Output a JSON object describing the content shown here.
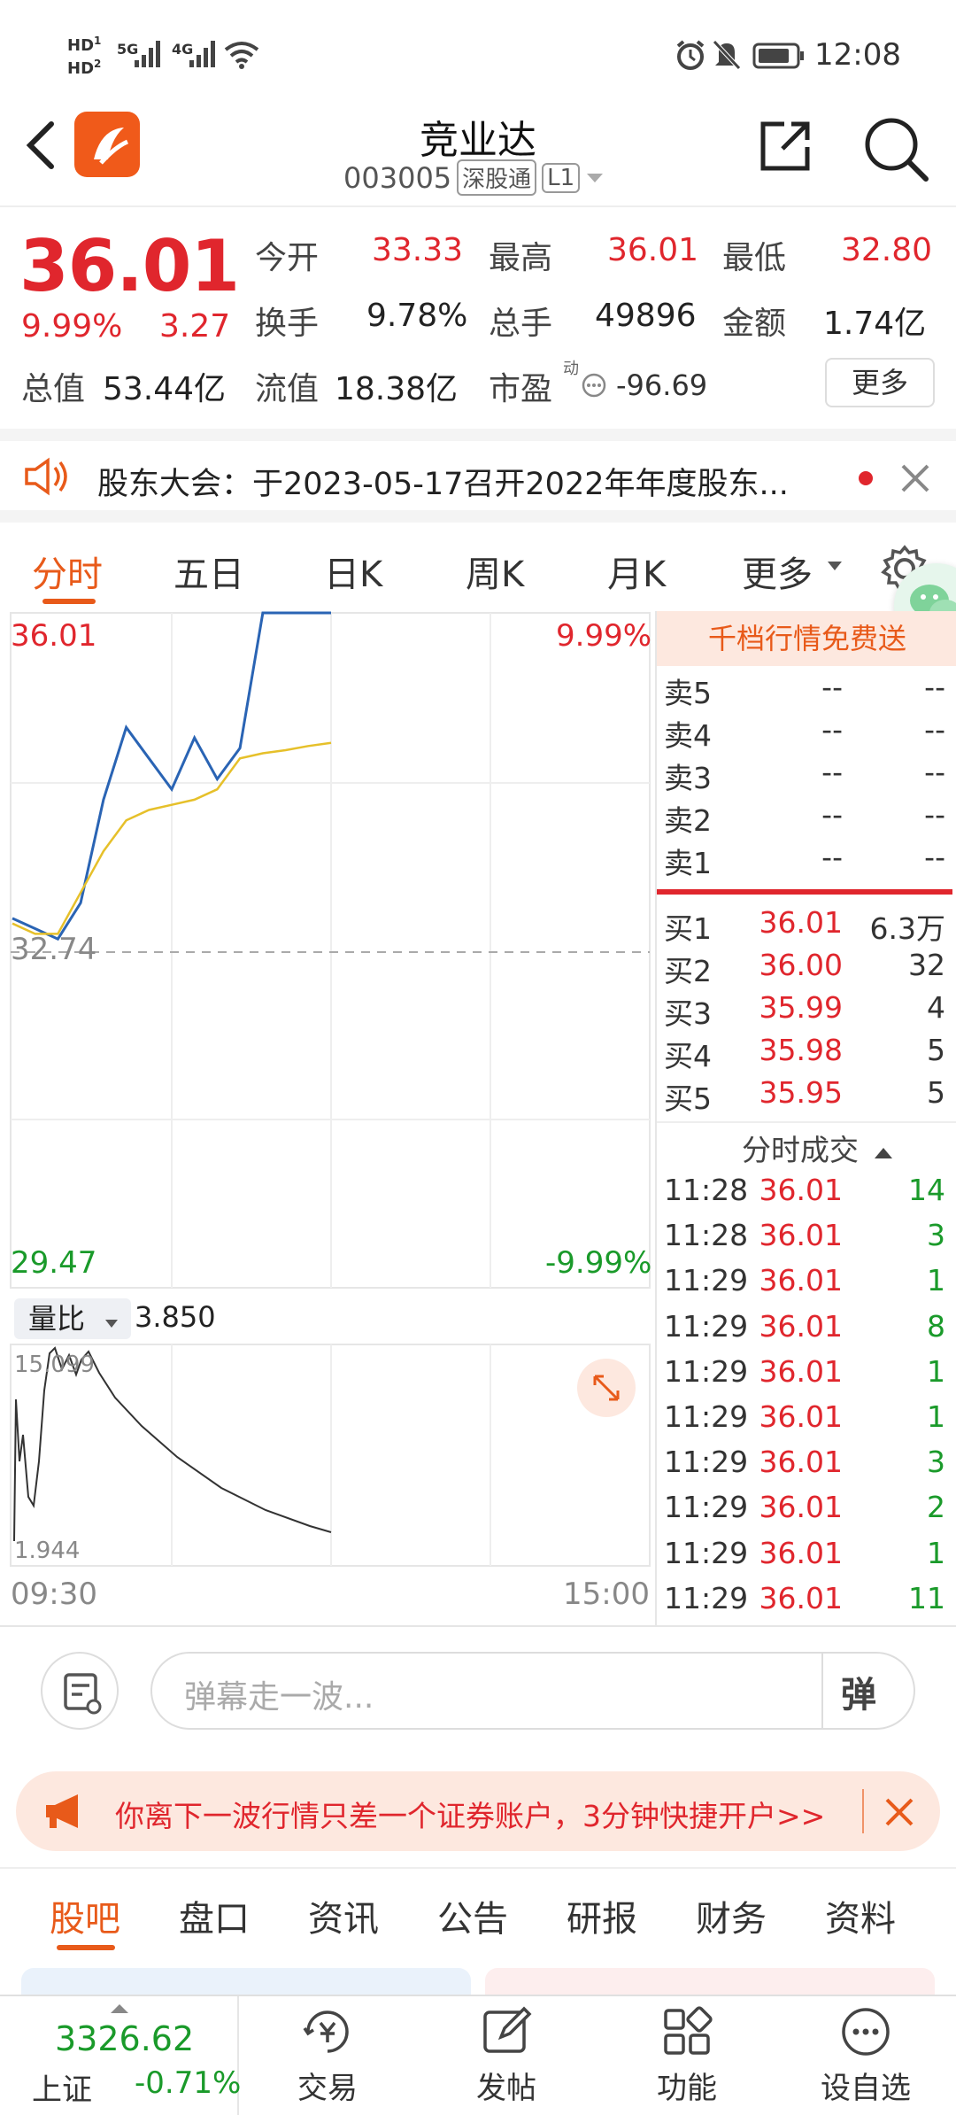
{
  "status": {
    "hd1": "HD",
    "hd2": "HD",
    "sig1": "5G",
    "sig2": "4G",
    "time": "12:08"
  },
  "nav": {
    "title": "竞业达",
    "code": "003005",
    "tag1": "深股通",
    "tag2": "L1"
  },
  "quote": {
    "price": "36.01",
    "pct": "9.99%",
    "change": "3.27",
    "open_label": "今开",
    "open": "33.33",
    "high_label": "最高",
    "high": "36.01",
    "low_label": "最低",
    "low": "32.80",
    "turnover_label": "换手",
    "turnover": "9.78%",
    "volume_label": "总手",
    "volume": "49896",
    "amount_label": "金额",
    "amount": "1.74亿",
    "mcap_label": "总值",
    "mcap": "53.44亿",
    "float_label": "流值",
    "float": "18.38亿",
    "pe_label": "市盈",
    "pe_sup": "动",
    "pe": "-96.69",
    "more": "更多"
  },
  "notice": {
    "text": "股东大会：于2023-05-17召开2022年年度股东..."
  },
  "tabs": [
    "分时",
    "五日",
    "日K",
    "周K",
    "月K",
    "更多"
  ],
  "chart": {
    "top_price": "36.01",
    "top_pct": "9.99%",
    "mid_price": "32.74",
    "bottom_price": "29.47",
    "bottom_pct": "-9.99%",
    "vol_label": "量比",
    "vol_value": "3.850",
    "vol_top": "15.099",
    "vol_bottom": "1.944",
    "time_start": "09:30",
    "time_end": "15:00"
  },
  "chart_data": {
    "type": "line",
    "title": "",
    "ylim": [
      29.47,
      36.01
    ],
    "series": [
      {
        "values": [
          33.05,
          32.95,
          32.85,
          33.2,
          34.2,
          34.9,
          34.6,
          34.3,
          34.8,
          34.4,
          34.7,
          36.01,
          36.01,
          36.01,
          36.01
        ]
      },
      {
        "values": [
          33.0,
          32.9,
          32.9,
          33.3,
          33.7,
          34.0,
          34.1,
          34.15,
          34.2,
          34.3,
          34.6,
          34.65,
          34.68,
          34.72,
          34.75
        ]
      }
    ]
  },
  "book": {
    "banner": "千档行情免费送",
    "asks": [
      {
        "label": "卖5",
        "price": "--",
        "vol": "--"
      },
      {
        "label": "卖4",
        "price": "--",
        "vol": "--"
      },
      {
        "label": "卖3",
        "price": "--",
        "vol": "--"
      },
      {
        "label": "卖2",
        "price": "--",
        "vol": "--"
      },
      {
        "label": "卖1",
        "price": "--",
        "vol": "--"
      }
    ],
    "bids": [
      {
        "label": "买1",
        "price": "36.01",
        "vol": "6.3万"
      },
      {
        "label": "买2",
        "price": "36.00",
        "vol": "32"
      },
      {
        "label": "买3",
        "price": "35.99",
        "vol": "4"
      },
      {
        "label": "买4",
        "price": "35.98",
        "vol": "5"
      },
      {
        "label": "买5",
        "price": "35.95",
        "vol": "5"
      }
    ],
    "trades_title": "分时成交",
    "trades": [
      {
        "time": "11:28",
        "price": "36.01",
        "vol": "14"
      },
      {
        "time": "11:28",
        "price": "36.01",
        "vol": "3"
      },
      {
        "time": "11:29",
        "price": "36.01",
        "vol": "1"
      },
      {
        "time": "11:29",
        "price": "36.01",
        "vol": "8"
      },
      {
        "time": "11:29",
        "price": "36.01",
        "vol": "1"
      },
      {
        "time": "11:29",
        "price": "36.01",
        "vol": "1"
      },
      {
        "time": "11:29",
        "price": "36.01",
        "vol": "3"
      },
      {
        "time": "11:29",
        "price": "36.01",
        "vol": "2"
      },
      {
        "time": "11:29",
        "price": "36.01",
        "vol": "1"
      },
      {
        "time": "11:29",
        "price": "36.01",
        "vol": "11"
      }
    ]
  },
  "danmu": {
    "placeholder": "弹幕走一波...",
    "btn": "弹"
  },
  "ad": {
    "text": "你离下一波行情只差一个证券账户，3分钟快捷开户>>"
  },
  "subtabs": [
    "股吧",
    "盘口",
    "资讯",
    "公告",
    "研报",
    "财务",
    "资料"
  ],
  "bottom": {
    "index_value": "3326.62",
    "index_name": "上证",
    "index_pct": "-0.71%",
    "items": [
      "交易",
      "发帖",
      "功能",
      "设自选"
    ]
  },
  "colors": {
    "up": "#e0262d",
    "down": "#1a9a2a",
    "accent": "#e85a1a",
    "line_price": "#2a64b4",
    "line_avg": "#e6c02a"
  }
}
